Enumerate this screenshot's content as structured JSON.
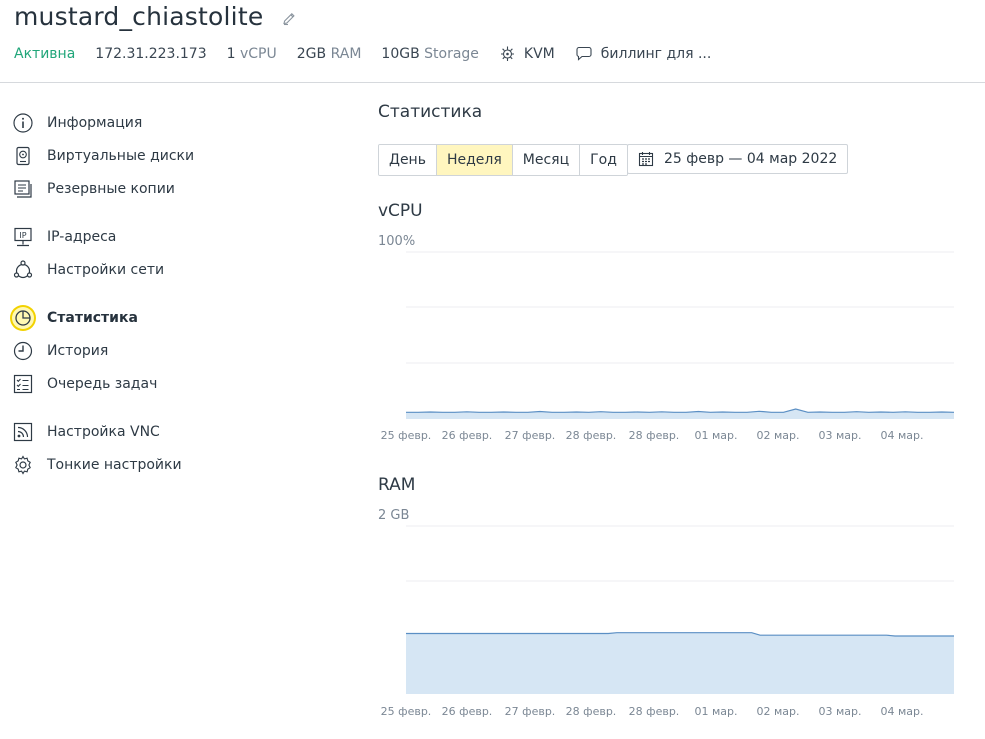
{
  "server": {
    "name": "mustard_chiastolite",
    "status": "Активна",
    "ip": "172.31.223.173",
    "vcpu_value": "1",
    "vcpu_unit": "vCPU",
    "ram_value": "2GB",
    "ram_unit": "RAM",
    "storage_value": "10GB",
    "storage_unit": "Storage",
    "virtualization": "KVM",
    "comment": "биллинг для ..."
  },
  "sidebar": {
    "items": [
      {
        "label": "Информация",
        "icon": "info-icon"
      },
      {
        "label": "Виртуальные диски",
        "icon": "disk-icon"
      },
      {
        "label": "Резервные копии",
        "icon": "backup-icon"
      },
      {
        "label": "IP-адреса",
        "icon": "ip-icon"
      },
      {
        "label": "Настройки сети",
        "icon": "network-icon"
      },
      {
        "label": "Статистика",
        "icon": "statistics-icon",
        "active": true
      },
      {
        "label": "История",
        "icon": "history-icon"
      },
      {
        "label": "Очередь задач",
        "icon": "task-queue-icon"
      },
      {
        "label": "Настройка VNC",
        "icon": "vnc-icon"
      },
      {
        "label": "Тонкие настройки",
        "icon": "gear-icon"
      }
    ]
  },
  "statistics": {
    "title": "Статистика",
    "periods": [
      "День",
      "Неделя",
      "Месяц",
      "Год"
    ],
    "active_period": "Неделя",
    "date_range": "25 февр — 04 мар 2022"
  },
  "colors": {
    "accent_active": "#fff6bf",
    "status_green": "#21a67a",
    "chart_line": "#5b8fc4",
    "chart_fill": "#d6e6f4"
  },
  "chart_data": [
    {
      "type": "area",
      "title": "vCPU",
      "max_label": "100%",
      "x": [
        "25 февр.",
        "26 февр.",
        "27 февр.",
        "28 февр.",
        "28 февр.",
        "01 мар.",
        "02 мар.",
        "03 мар.",
        "04 мар."
      ],
      "ylim": [
        0,
        100
      ],
      "series": [
        {
          "values": [
            4,
            4,
            4.2,
            4,
            4,
            4.3,
            4,
            4,
            4.2,
            4,
            4,
            4.5,
            4,
            4,
            4.2,
            4,
            4.4,
            4,
            4,
            4.2,
            4,
            4.3,
            4,
            4,
            4.5,
            4,
            4.2,
            4,
            4,
            4.6,
            4,
            4,
            6,
            4,
            4.2,
            4,
            4,
            4.4,
            4,
            4.2,
            4,
            4.3,
            4,
            4,
            4.2,
            4
          ]
        }
      ],
      "grid": true
    },
    {
      "type": "area",
      "title": "RAM",
      "max_label": "2 GB",
      "x": [
        "25 февр.",
        "26 февр.",
        "27 февр.",
        "28 февр.",
        "28 февр.",
        "01 мар.",
        "02 мар.",
        "03 мар.",
        "04 мар."
      ],
      "ylim": [
        0,
        2
      ],
      "series": [
        {
          "values": [
            0.72,
            0.72,
            0.72,
            0.72,
            0.72,
            0.72,
            0.72,
            0.72,
            0.72,
            0.72,
            0.72,
            0.72,
            0.72,
            0.72,
            0.72,
            0.72,
            0.72,
            0.72,
            0.72,
            0.72,
            0.72,
            0.72,
            0.72,
            0.72,
            0.72,
            0.73,
            0.73,
            0.73,
            0.73,
            0.73,
            0.73,
            0.73,
            0.73,
            0.73,
            0.73,
            0.73,
            0.73,
            0.73,
            0.73,
            0.73,
            0.73,
            0.73,
            0.7,
            0.7,
            0.7,
            0.7,
            0.7,
            0.7,
            0.7,
            0.7,
            0.7,
            0.7,
            0.7,
            0.7,
            0.7,
            0.7,
            0.7,
            0.7,
            0.69,
            0.69,
            0.69,
            0.69,
            0.69,
            0.69,
            0.69,
            0.69
          ]
        }
      ],
      "grid": true
    }
  ]
}
